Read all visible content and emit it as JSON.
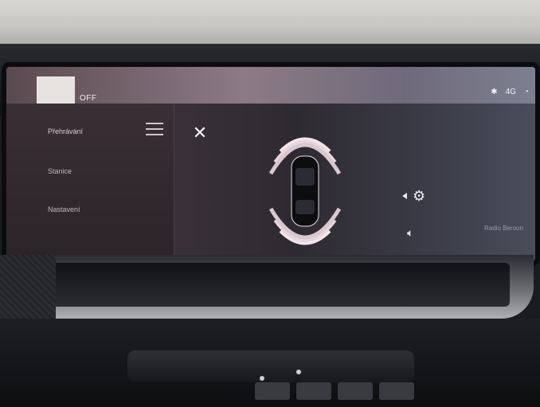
{
  "status_bar": {
    "label": "OFF",
    "icons": [
      "bluetooth-icon",
      "4g-icon",
      "signal-icon"
    ]
  },
  "sidebar": {
    "items": [
      {
        "label": "Přehrávání"
      },
      {
        "label": "Stanice"
      },
      {
        "label": "Nastavení"
      }
    ]
  },
  "overlay": {
    "close_icon": "close-icon",
    "menu_icon": "hamburger-icon",
    "parking_sensor": "parking-sensor-icon",
    "settings_icon": "gear-icon",
    "sound_icon": "speaker-icon",
    "camera_icon": "camera-icon"
  },
  "faint_text": "Radio Beroun",
  "accent_colors": {
    "sensor_front": "#f2e6e9",
    "sensor_rear": "#efe3e7",
    "screen_bg": "#3a3137"
  }
}
